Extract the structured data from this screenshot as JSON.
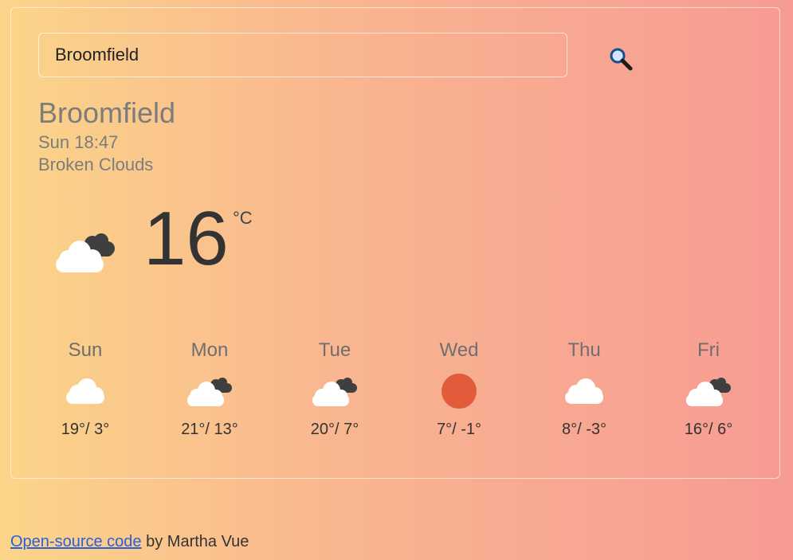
{
  "search": {
    "value": "Broomfield",
    "icon": "search-icon"
  },
  "current": {
    "city": "Broomfield",
    "datetime": "Sun 18:47",
    "description": "Broken Clouds",
    "temperature": "16",
    "unit": "°C",
    "icon": "broken-clouds-icon"
  },
  "forecast": [
    {
      "day": "Sun",
      "temps": "19°/ 3°",
      "icon": "cloud-icon"
    },
    {
      "day": "Mon",
      "temps": "21°/ 13°",
      "icon": "broken-clouds-icon"
    },
    {
      "day": "Tue",
      "temps": "20°/ 7°",
      "icon": "broken-clouds-icon"
    },
    {
      "day": "Wed",
      "temps": "7°/ -1°",
      "icon": "sun-icon"
    },
    {
      "day": "Thu",
      "temps": "8°/ -3°",
      "icon": "cloud-icon"
    },
    {
      "day": "Fri",
      "temps": "16°/ 6°",
      "icon": "broken-clouds-icon"
    }
  ],
  "footer": {
    "link_text": "Open-source code",
    "suffix": " by Martha Vue"
  },
  "colors": {
    "sun": "#e25c3c",
    "cloud": "#ffffff",
    "dark_cloud": "#3f3f3f"
  }
}
